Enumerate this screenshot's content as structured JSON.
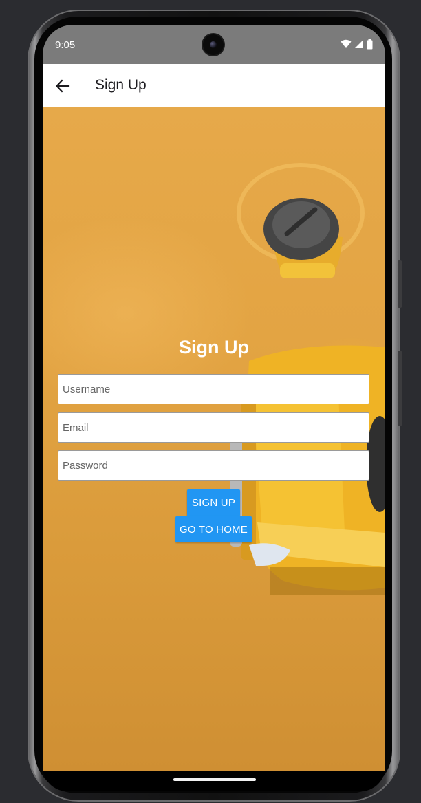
{
  "status_bar": {
    "time": "9:05",
    "icons": [
      "wifi-icon",
      "signal-icon",
      "battery-icon"
    ]
  },
  "app_bar": {
    "back_icon": "arrow-left-icon",
    "title": "Sign Up"
  },
  "form": {
    "heading": "Sign Up",
    "username_placeholder": "Username",
    "email_placeholder": "Email",
    "password_placeholder": "Password",
    "sign_up_button": "SIGN UP",
    "go_home_button": "GO TO HOME"
  },
  "colors": {
    "status_bar": "#7b7b7b",
    "app_bar": "#ffffff",
    "accent": "#2196f3",
    "background_photo": "#e3a443"
  }
}
